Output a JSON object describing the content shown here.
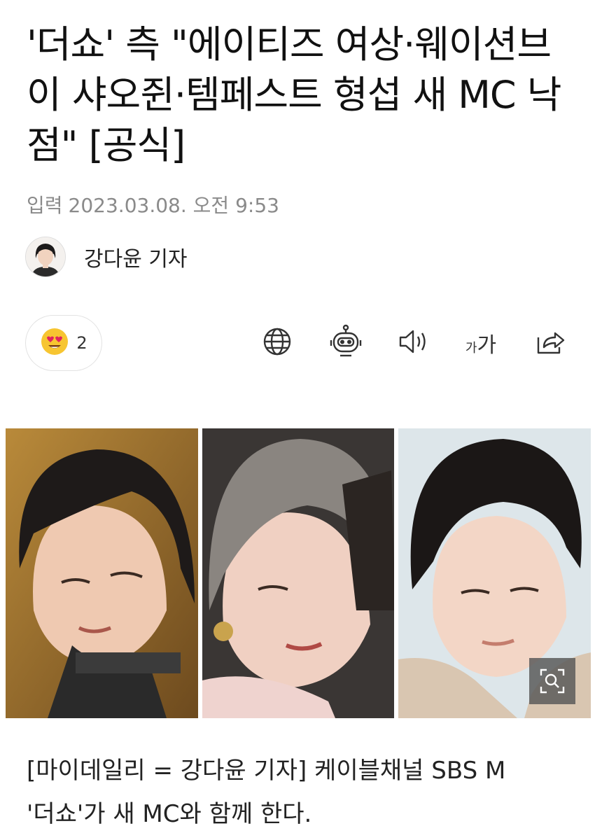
{
  "article": {
    "headline": "'더쇼' 측 \"에이티즈 여상·웨이션브이 샤오쥔·템페스트 형섭 새 MC 낙점\" [공식]",
    "date_label": "입력",
    "date_value": "2023.03.08. 오전 9:53",
    "reporter": "강다윤 기자",
    "body_line_1": "[마이데일리 = 강다윤 기자] 케이블채널 SBS M",
    "body_line_2": "'더쇼'가 새 MC와 함께 한다."
  },
  "reaction": {
    "emoji": "heart-eyes-emoji",
    "count": "2"
  },
  "toolbar": {
    "icons": [
      "globe-icon",
      "robot-icon",
      "speaker-icon",
      "font-size-icon",
      "share-icon"
    ],
    "font_small": "가",
    "font_large": "가"
  },
  "colors": {
    "text": "#111111",
    "meta": "#8a8a8a",
    "emoji": "#f7c531",
    "heart": "#e0245e"
  }
}
